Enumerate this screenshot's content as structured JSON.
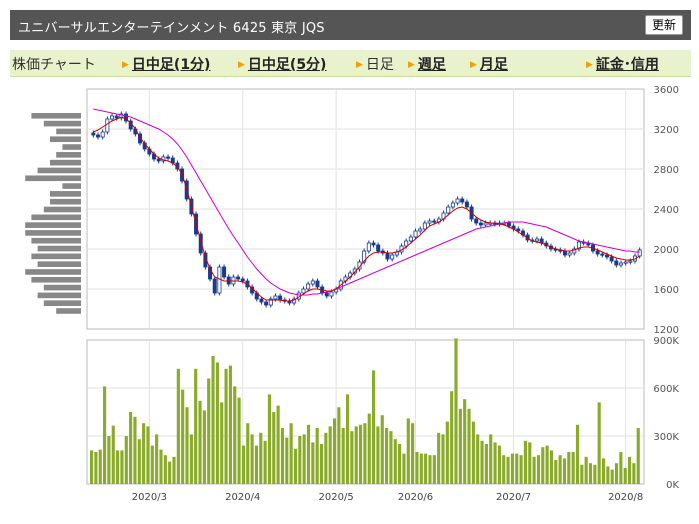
{
  "header": {
    "title": "ユニバーサルエンターテインメント 6425 東京 JQS",
    "refresh_label": "更新"
  },
  "tabs": [
    {
      "label": "株価チャート",
      "style": "plain",
      "arrow": false
    },
    {
      "label": "日中足(1分)",
      "style": "bold",
      "arrow": true
    },
    {
      "label": "日中足(5分)",
      "style": "bold",
      "arrow": true
    },
    {
      "label": "日足",
      "style": "plain",
      "arrow": true
    },
    {
      "label": "週足",
      "style": "bold",
      "arrow": true
    },
    {
      "label": "月足",
      "style": "bold",
      "arrow": true
    },
    {
      "label": "証金･信用",
      "style": "bold",
      "arrow": true
    }
  ],
  "colors": {
    "accent_arrow": "#f0a000",
    "header_bg": "#555555",
    "tab_bg": "#e8f2cc",
    "candle": "#1a3a8c",
    "ma_short": "#cc0000",
    "ma_long": "#cc00cc",
    "volume_bar": "#8aaa2a",
    "volume_profile": "#888888"
  },
  "chart_data": [
    {
      "type": "candlestick",
      "ylim": [
        1200,
        3600
      ],
      "y_ticks": [
        "3600",
        "3200",
        "2800",
        "2400",
        "2000",
        "1600",
        "1200"
      ],
      "x_ticks": [
        "2020/3",
        "2020/4",
        "2020/5",
        "2020/6",
        "2020/7",
        "2020/8"
      ],
      "series": [
        {
          "name": "close",
          "values": [
            3140,
            3120,
            3170,
            3300,
            3330,
            3310,
            3350,
            3280,
            3200,
            3150,
            3060,
            3000,
            2950,
            2900,
            2880,
            2920,
            2910,
            2860,
            2800,
            2680,
            2500,
            2350,
            2150,
            1960,
            1820,
            1700,
            1560,
            1820,
            1720,
            1650,
            1720,
            1700,
            1680,
            1620,
            1560,
            1500,
            1470,
            1440,
            1500,
            1530,
            1490,
            1480,
            1460,
            1500,
            1560,
            1600,
            1650,
            1680,
            1620,
            1560,
            1530,
            1570,
            1600,
            1680,
            1720,
            1760,
            1800,
            1870,
            1980,
            2060,
            2040,
            1980,
            1960,
            1900,
            1940,
            1970,
            2030,
            2080,
            2120,
            2180,
            2200,
            2260,
            2280,
            2270,
            2300,
            2360,
            2420,
            2460,
            2500,
            2470,
            2420,
            2300,
            2260,
            2240,
            2260,
            2260,
            2250,
            2260,
            2260,
            2230,
            2200,
            2180,
            2140,
            2090,
            2080,
            2100,
            2060,
            2030,
            2000,
            1990,
            1980,
            1940,
            1960,
            2000,
            2070,
            2060,
            2040,
            1980,
            1950,
            1940,
            1920,
            1880,
            1840,
            1860,
            1870,
            1880,
            1930,
            1990
          ]
        },
        {
          "name": "ma_short",
          "values": [
            3170,
            3190,
            3220,
            3250,
            3280,
            3300,
            3320,
            3300,
            3260,
            3200,
            3120,
            3050,
            3000,
            2950,
            2910,
            2890,
            2880,
            2860,
            2820,
            2750,
            2600,
            2430,
            2250,
            2080,
            1920,
            1800,
            1720,
            1700,
            1680,
            1680,
            1680,
            1680,
            1670,
            1650,
            1610,
            1560,
            1520,
            1490,
            1490,
            1490,
            1490,
            1480,
            1480,
            1490,
            1520,
            1550,
            1580,
            1600,
            1600,
            1590,
            1580,
            1580,
            1600,
            1640,
            1680,
            1720,
            1770,
            1820,
            1880,
            1930,
            1960,
            1970,
            1970,
            1960,
            1960,
            1970,
            1990,
            2020,
            2060,
            2100,
            2140,
            2190,
            2230,
            2250,
            2270,
            2300,
            2340,
            2380,
            2410,
            2420,
            2400,
            2360,
            2320,
            2290,
            2270,
            2260,
            2260,
            2250,
            2240,
            2220,
            2200,
            2170,
            2140,
            2110,
            2080,
            2070,
            2060,
            2040,
            2020,
            2000,
            1990,
            1980,
            1980,
            1990,
            2010,
            2020,
            2020,
            2010,
            1990,
            1970,
            1950,
            1930,
            1910,
            1900,
            1890,
            1890,
            1900,
            1930
          ]
        },
        {
          "name": "ma_long",
          "values": [
            3400,
            3390,
            3380,
            3370,
            3360,
            3350,
            3340,
            3330,
            3320,
            3300,
            3280,
            3260,
            3240,
            3220,
            3200,
            3170,
            3140,
            3100,
            3050,
            2990,
            2920,
            2840,
            2760,
            2680,
            2600,
            2520,
            2440,
            2360,
            2280,
            2200,
            2130,
            2060,
            1990,
            1920,
            1860,
            1800,
            1750,
            1700,
            1660,
            1630,
            1600,
            1580,
            1560,
            1550,
            1540,
            1540,
            1540,
            1550,
            1550,
            1560,
            1570,
            1580,
            1600,
            1620,
            1640,
            1660,
            1680,
            1700,
            1720,
            1740,
            1760,
            1780,
            1800,
            1820,
            1840,
            1860,
            1880,
            1900,
            1920,
            1940,
            1960,
            1980,
            2000,
            2020,
            2040,
            2060,
            2080,
            2100,
            2120,
            2140,
            2160,
            2180,
            2200,
            2210,
            2220,
            2230,
            2240,
            2250,
            2260,
            2270,
            2270,
            2270,
            2270,
            2260,
            2250,
            2240,
            2230,
            2220,
            2200,
            2180,
            2160,
            2140,
            2120,
            2100,
            2080,
            2070,
            2060,
            2050,
            2040,
            2030,
            2020,
            2010,
            2000,
            1990,
            1980,
            1980,
            1970,
            1970
          ]
        }
      ]
    },
    {
      "type": "bar",
      "name": "volume",
      "ylim": [
        0,
        900000
      ],
      "y_ticks": [
        "900K",
        "600K",
        "300K",
        "0K"
      ],
      "values": [
        210000,
        200000,
        215000,
        610000,
        300000,
        365000,
        210000,
        210000,
        300000,
        450000,
        420000,
        280000,
        380000,
        360000,
        240000,
        310000,
        215000,
        180000,
        140000,
        170000,
        720000,
        590000,
        480000,
        310000,
        720000,
        520000,
        460000,
        660000,
        800000,
        760000,
        510000,
        720000,
        740000,
        610000,
        540000,
        240000,
        380000,
        310000,
        240000,
        320000,
        270000,
        560000,
        450000,
        490000,
        350000,
        290000,
        380000,
        220000,
        300000,
        310000,
        370000,
        260000,
        350000,
        250000,
        320000,
        360000,
        410000,
        480000,
        350000,
        560000,
        330000,
        360000,
        370000,
        380000,
        440000,
        710000,
        360000,
        430000,
        350000,
        330000,
        280000,
        250000,
        190000,
        410000,
        380000,
        200000,
        190000,
        190000,
        180000,
        180000,
        320000,
        310000,
        390000,
        580000,
        910000,
        470000,
        530000,
        470000,
        390000,
        310000,
        270000,
        250000,
        310000,
        260000,
        240000,
        180000,
        170000,
        190000,
        190000,
        180000,
        270000,
        260000,
        170000,
        180000,
        230000,
        240000,
        210000,
        150000,
        180000,
        160000,
        200000,
        200000,
        370000,
        120000,
        170000,
        130000,
        120000,
        510000,
        160000,
        110000,
        90000,
        130000,
        200000,
        100000,
        170000,
        130000,
        350000
      ]
    },
    {
      "type": "bar",
      "name": "price_volume_profile",
      "orientation": "horizontal",
      "values": [
        0.8,
        0.6,
        0.4,
        0.5,
        0.3,
        0.4,
        0.5,
        0.7,
        0.9,
        0.3,
        0.5,
        0.5,
        0.6,
        0.8,
        0.9,
        0.9,
        0.8,
        0.7,
        0.8,
        0.7,
        0.9,
        0.8,
        0.6,
        0.7,
        0.6,
        0.4
      ]
    }
  ]
}
